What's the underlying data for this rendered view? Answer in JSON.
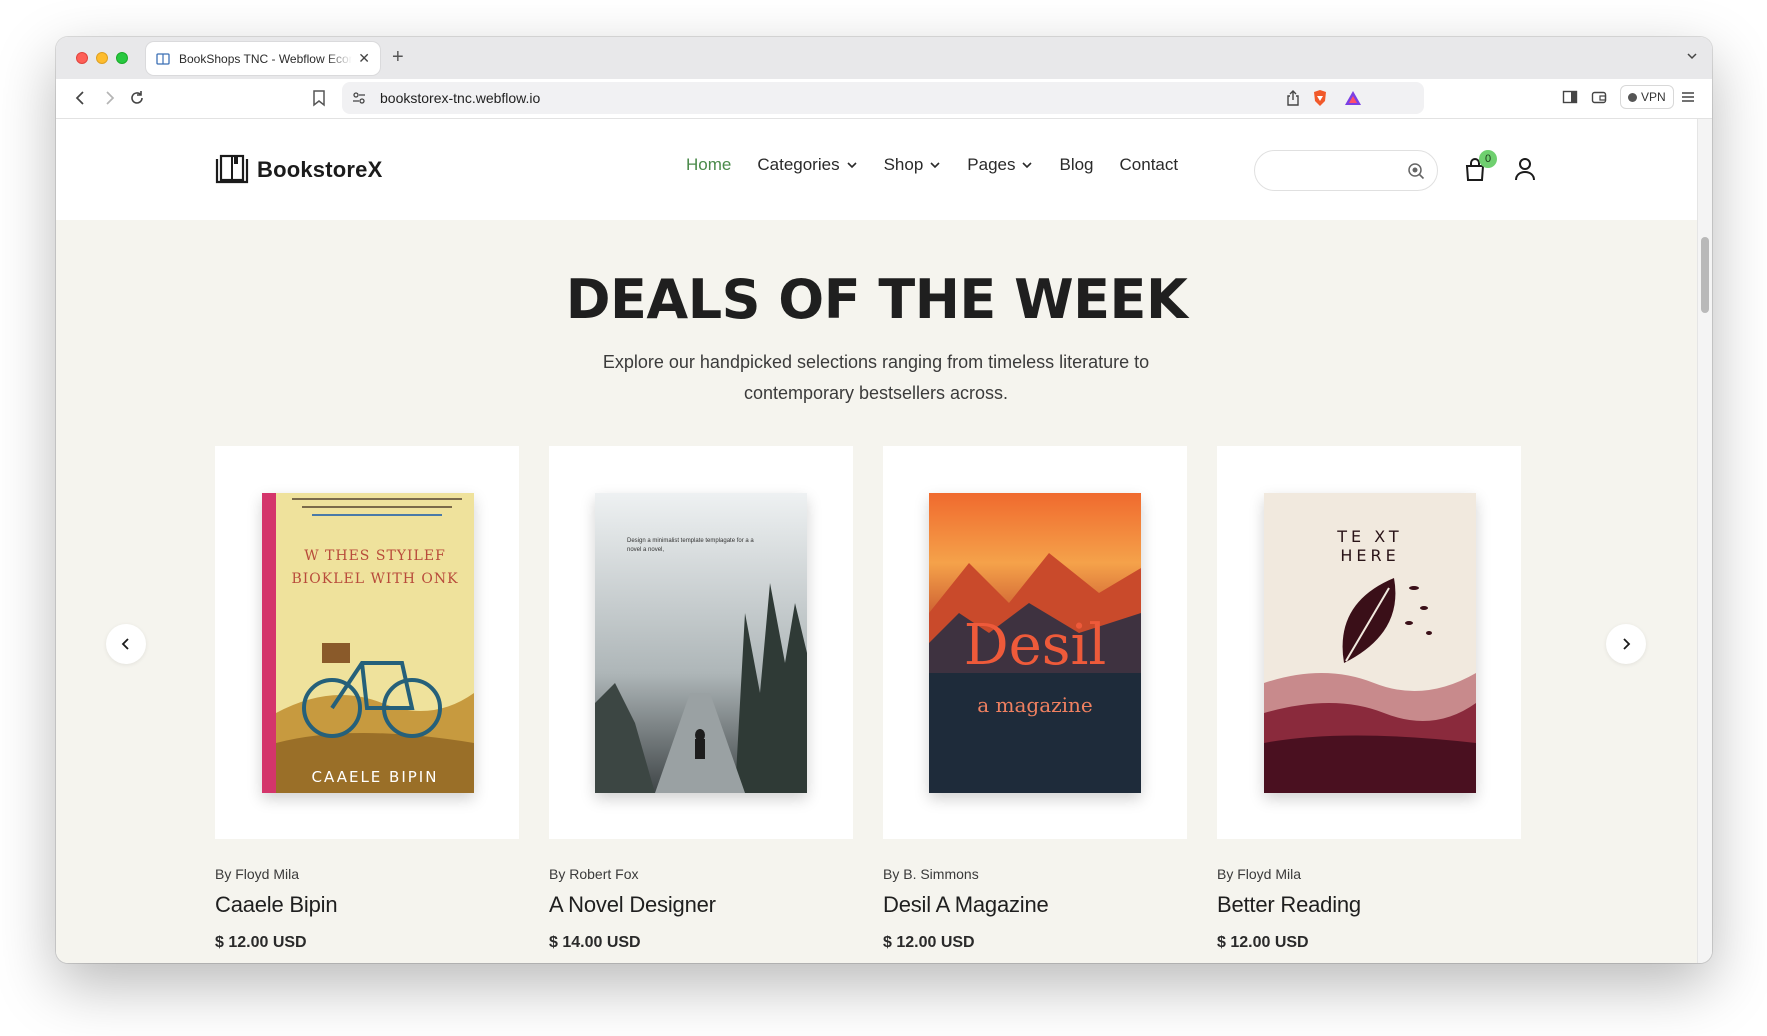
{
  "browser": {
    "tab_title": "BookShops TNC - Webflow Ecommerce",
    "url": "bookstorex-tnc.webflow.io",
    "vpn_label": "VPN"
  },
  "header": {
    "logo_text": "BookstoreX",
    "nav": [
      {
        "label": "Home",
        "active": true
      },
      {
        "label": "Categories",
        "dropdown": true
      },
      {
        "label": "Shop",
        "dropdown": true
      },
      {
        "label": "Pages",
        "dropdown": true
      },
      {
        "label": "Blog"
      },
      {
        "label": "Contact"
      }
    ],
    "search_placeholder": "",
    "cart_count": "0",
    "accent_color": "#4a8a4a"
  },
  "deals": {
    "title": "DEALS OF THE WEEK",
    "subtitle": "Explore our handpicked selections ranging from timeless literature to contemporary bestsellers across.",
    "products": [
      {
        "author": "By Floyd Mila",
        "title": "Caaele Bipin",
        "price": "$ 12.00 USD",
        "cover_text": "W THES STYILEF BIOKLEL WITH ONK",
        "cover_bottom": "CAAELE BIPIN"
      },
      {
        "author": "By Robert Fox",
        "title": "A Novel Designer",
        "price": "$ 14.00 USD",
        "cover_text": "Design a minimalist template templagate for a a novel a novel,"
      },
      {
        "author": "By B. Simmons",
        "title": "Desil A Magazine",
        "price": "$ 12.00 USD",
        "cover_text": "Desil",
        "cover_sub": "a magazine"
      },
      {
        "author": "By Floyd Mila",
        "title": "Better Reading",
        "price": "$ 12.00 USD",
        "cover_text": "TE XT HERE"
      }
    ]
  }
}
